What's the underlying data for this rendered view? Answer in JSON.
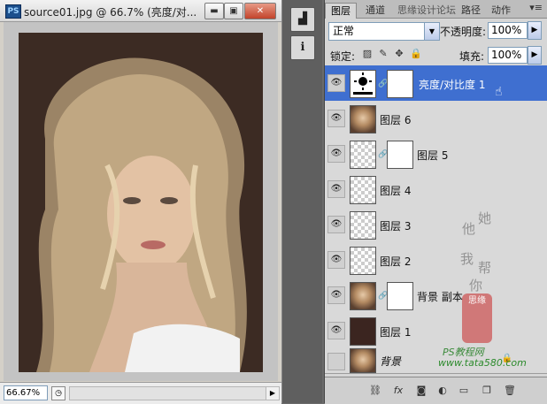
{
  "document": {
    "app_icon": "PS",
    "title": "source01.jpg @ 66.7% (亮度/对...",
    "zoom": "66.67%",
    "minimize_icon": "minimize-icon",
    "restore_icon": "restore-icon",
    "close_icon": "close-icon",
    "min_glyph": "▬",
    "max_glyph": "▣",
    "close_glyph": "✕"
  },
  "panel": {
    "tabs": [
      "图层",
      "通道",
      "思缘设计论坛",
      "路径",
      "动作"
    ],
    "menu_glyph": "▾≡",
    "blend_mode": "正常",
    "opacity_label": "不透明度:",
    "opacity_value": "100%",
    "lock_label": "锁定:",
    "fill_label": "填充:",
    "fill_value": "100%"
  },
  "layers": [
    {
      "name": "亮度/对比度 1",
      "thumb": "adjustment",
      "mask": true,
      "selected": true
    },
    {
      "name": "图层 6",
      "thumb": "photo",
      "mask": false,
      "selected": false
    },
    {
      "name": "图层 5",
      "thumb": "transparent",
      "mask": true,
      "selected": false
    },
    {
      "name": "图层 4",
      "thumb": "transparent",
      "mask": false,
      "selected": false
    },
    {
      "name": "图层 3",
      "thumb": "transparent",
      "mask": false,
      "selected": false
    },
    {
      "name": "图层 2",
      "thumb": "transparent",
      "mask": false,
      "selected": false
    },
    {
      "name": "背景 副本",
      "thumb": "photo",
      "mask": true,
      "selected": false
    },
    {
      "name": "图层 1",
      "thumb": "dark",
      "mask": false,
      "selected": false
    },
    {
      "name": "背景",
      "thumb": "photo",
      "mask": false,
      "selected": false,
      "locked": true,
      "hidden": true
    }
  ],
  "watermarks": {
    "left": "他",
    "right": "她",
    "mid1": "我",
    "mid2": "帮",
    "mid3": "你",
    "stamp": "思缘",
    "ps_text": "PS教程网",
    "site": "www.tata580.com"
  }
}
